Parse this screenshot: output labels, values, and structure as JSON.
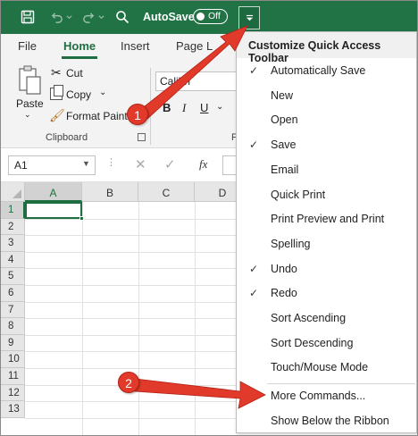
{
  "title_bar": {
    "autosave_label": "AutoSave",
    "autosave_state": "Off",
    "accent_color": "#217346"
  },
  "ribbon": {
    "tabs": [
      "File",
      "Home",
      "Insert",
      "Page L"
    ],
    "clipboard": {
      "paste_label": "Paste",
      "cut_label": "Cut",
      "copy_label": "Copy",
      "format_painter_label": "Format Painter",
      "group_label": "Clipboard"
    },
    "font": {
      "font_name": "Calibri",
      "bold": "B",
      "italic": "I",
      "underline": "U",
      "group_label": "F"
    }
  },
  "formula_bar": {
    "name_box": "A1",
    "fx_label": "fx"
  },
  "grid": {
    "columns": [
      "A",
      "B",
      "C",
      "D"
    ],
    "rows": [
      "1",
      "2",
      "3",
      "4",
      "5",
      "6",
      "7",
      "8",
      "9",
      "10",
      "11",
      "12",
      "13"
    ],
    "selected_cell": "A1"
  },
  "qat_menu": {
    "title": "Customize Quick Access Toolbar",
    "items": [
      {
        "label": "Automatically Save",
        "checked": true
      },
      {
        "label": "New",
        "checked": false
      },
      {
        "label": "Open",
        "checked": false
      },
      {
        "label": "Save",
        "checked": true
      },
      {
        "label": "Email",
        "checked": false
      },
      {
        "label": "Quick Print",
        "checked": false
      },
      {
        "label": "Print Preview and Print",
        "checked": false
      },
      {
        "label": "Spelling",
        "checked": false
      },
      {
        "label": "Undo",
        "checked": true
      },
      {
        "label": "Redo",
        "checked": true
      },
      {
        "label": "Sort Ascending",
        "checked": false
      },
      {
        "label": "Sort Descending",
        "checked": false
      },
      {
        "label": "Touch/Mouse Mode",
        "checked": false
      },
      {
        "label": "More Commands...",
        "checked": false
      },
      {
        "label": "Show Below the Ribbon",
        "checked": false
      }
    ]
  },
  "annotations": {
    "badge_1": "1",
    "badge_2": "2",
    "color": "#e23a2a"
  }
}
